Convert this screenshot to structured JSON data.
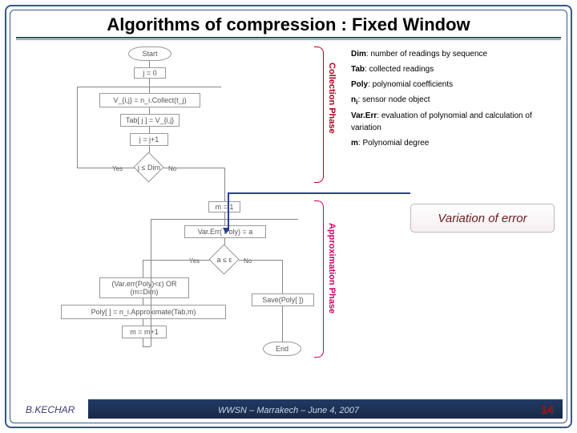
{
  "title": "Algorithms of compression : Fixed Window",
  "legend": {
    "dim": {
      "term": "Dim",
      "def": ": number of readings by sequence"
    },
    "tab": {
      "term": "Tab",
      "def": ": collected readings"
    },
    "poly": {
      "term": "Poly",
      "def": ": polynomial coefficients"
    },
    "ni": {
      "term": "n",
      "sub": "i",
      "def": ": sensor node object"
    },
    "varerr": {
      "term": "Var.Err",
      "def": ": evaluation of polynomial and calculation of variation"
    },
    "m": {
      "term": "m",
      "def": ": Polynomial degree"
    }
  },
  "variation_label": "Variation of error",
  "flow": {
    "start": "Start",
    "j_init": "j = 0",
    "collect": "V_{i,j} = n_i.Collect(t_j)",
    "tab_assign": "Tab[ j ] = V_{i,j}",
    "j_inc": "j = j+1",
    "j_test": "j ≤ Dim",
    "yes": "Yes",
    "no": "No",
    "m_init": "m = 1",
    "varerr": "Var.Err( Poly) = a",
    "a_test": "a ≤ ε",
    "brk_cond": "(Var.err(Poly)<ε) OR (m=Dim)",
    "approx": "Poly[ ] = n_i.Approximate(Tab,m)",
    "save": "Save(Poly[ ])",
    "m_inc": "m = m+1",
    "end": "End"
  },
  "phases": {
    "collection": "Collection Phase",
    "approx": "Approximation Phase"
  },
  "footer": {
    "author": "B.KECHAR",
    "conf": "WWSN – Marrakech – June 4, 2007",
    "page": "14"
  }
}
